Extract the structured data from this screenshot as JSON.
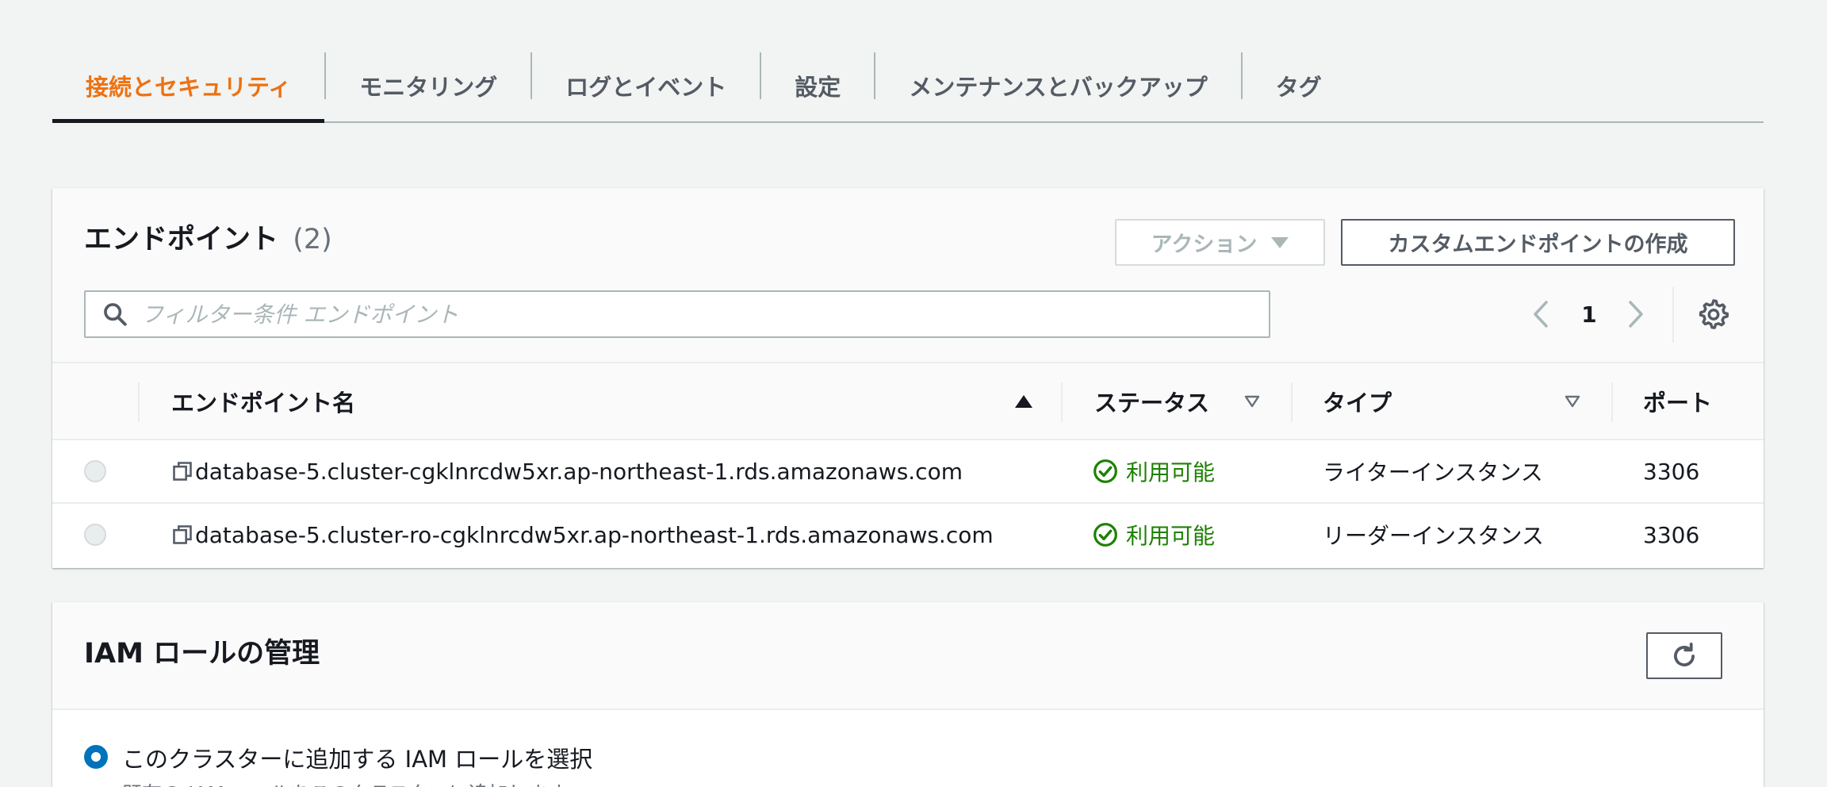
{
  "tabs": [
    {
      "label": "接続とセキュリティ",
      "active": true
    },
    {
      "label": "モニタリング"
    },
    {
      "label": "ログとイベント"
    },
    {
      "label": "設定"
    },
    {
      "label": "メンテナンスとバックアップ"
    },
    {
      "label": "タグ"
    }
  ],
  "endpoints": {
    "title": "エンドポイント",
    "count": "(2)",
    "actions_label": "アクション",
    "create_label": "カスタムエンドポイントの作成",
    "search_placeholder": "フィルター条件 エンドポイント",
    "page": "1",
    "columns": {
      "name": "エンドポイント名",
      "status": "ステータス",
      "type": "タイプ",
      "port": "ポート"
    },
    "rows": [
      {
        "name": "database-5.cluster-cgklnrcdw5xr.ap-northeast-1.rds.amazonaws.com",
        "status": "利用可能",
        "type": "ライターインスタンス",
        "port": "3306"
      },
      {
        "name": "database-5.cluster-ro-cgklnrcdw5xr.ap-northeast-1.rds.amazonaws.com",
        "status": "利用可能",
        "type": "リーダーインスタンス",
        "port": "3306"
      }
    ]
  },
  "iam": {
    "title": "IAM ロールの管理",
    "option_label": "このクラスターに追加する IAM ロールを選択",
    "option_desc": "既存の IAM ロールをこのクラスターに追加します。"
  },
  "colors": {
    "accent_orange": "#ec7211",
    "status_green": "#1d8102",
    "radio_blue": "#0073bb"
  }
}
